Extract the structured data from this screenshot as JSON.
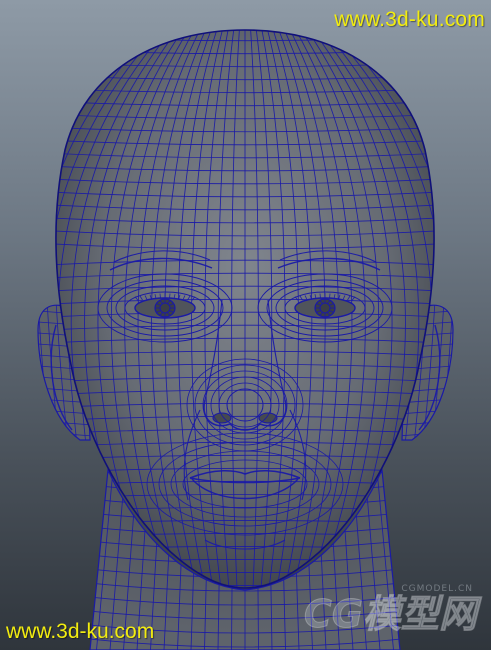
{
  "viewport": {
    "background_top": "#8e9aa6",
    "background_bottom": "#2f353c",
    "mesh_fill": "#6a6f77",
    "wire_color": "#1a1aa6"
  },
  "watermark": {
    "top_url": "www.3d-ku.com",
    "bottom_url": "www.3d-ku.com",
    "cg_small": "CGMODEL.CN",
    "cg_logo": "CG模型网",
    "color": "#f2ec10"
  }
}
